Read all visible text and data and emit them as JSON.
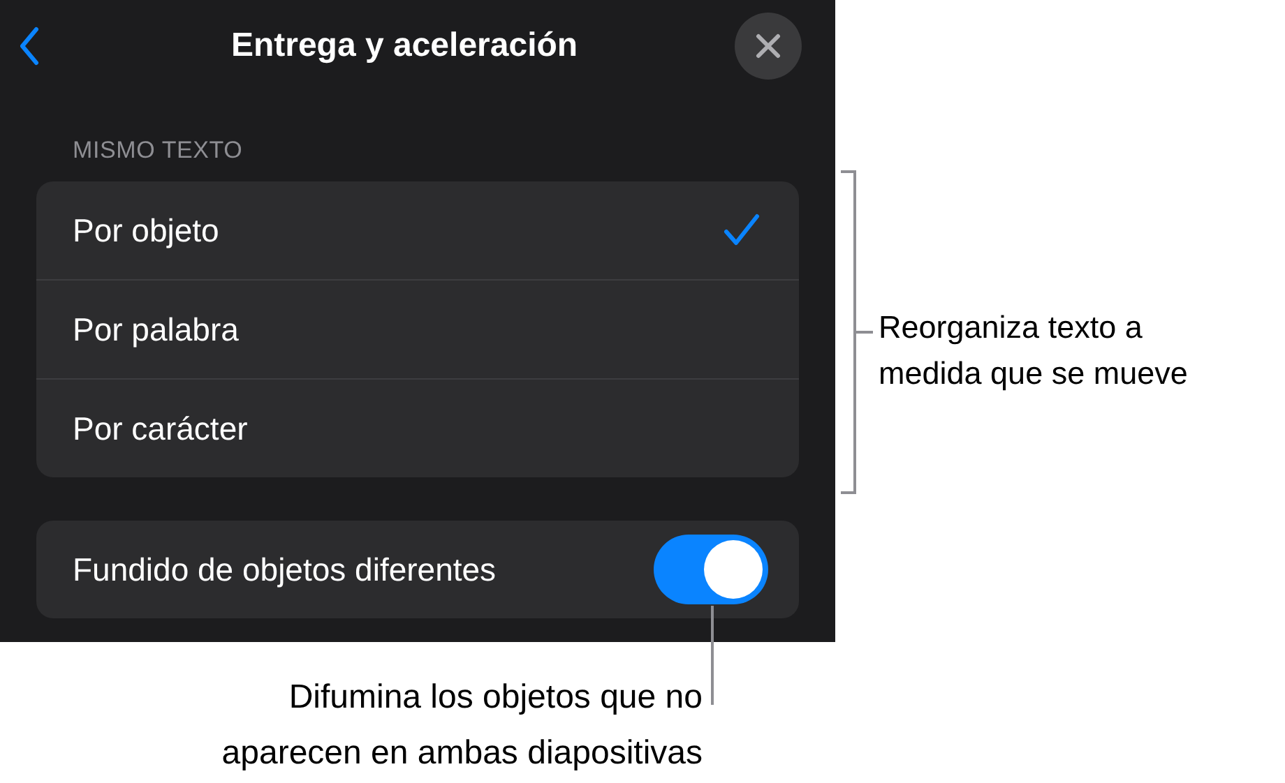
{
  "header": {
    "title": "Entrega y aceleración"
  },
  "section": {
    "label": "MISMO TEXTO",
    "options": [
      {
        "label": "Por objeto",
        "selected": true
      },
      {
        "label": "Por palabra",
        "selected": false
      },
      {
        "label": "Por carácter",
        "selected": false
      }
    ]
  },
  "toggle": {
    "label": "Fundido de objetos diferentes",
    "on": true
  },
  "callouts": [
    {
      "kind": "side",
      "text": "Reorganiza texto a medida que se mueve"
    },
    {
      "kind": "below",
      "text": "Difumina los objetos que no aparecen en ambas diapositivas"
    }
  ]
}
